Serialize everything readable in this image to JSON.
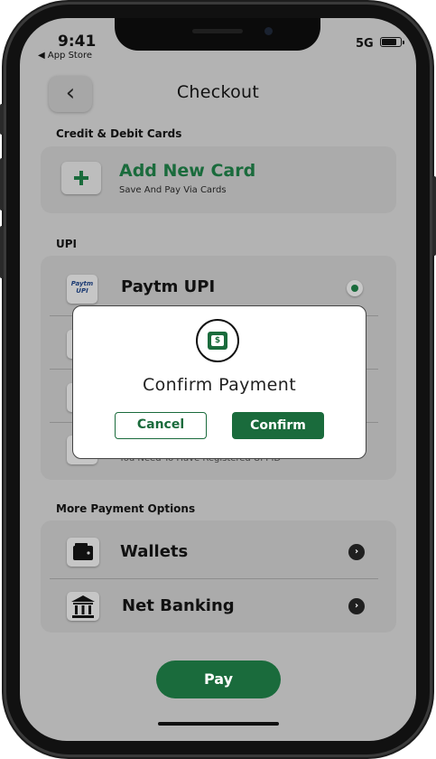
{
  "status_bar": {
    "time": "9:41",
    "back_app": "◀ App Store",
    "network": "5G"
  },
  "header": {
    "title": "Checkout",
    "back_icon": "chevron-left-icon"
  },
  "sections": {
    "cards": "Credit & Debit Cards",
    "upi": "UPI",
    "more": "More Payment Options"
  },
  "add_card": {
    "title": "Add New Card",
    "subtitle": "Save And Pay Via Cards",
    "icon": "plus-icon"
  },
  "upi_options": [
    {
      "label": "Paytm UPI",
      "logo_top": "Paytm",
      "logo_bottom": "UPI",
      "selected": true
    },
    {
      "subtitle": "You Need To Have Registered UPI ID"
    }
  ],
  "more_options": [
    {
      "label": "Wallets",
      "icon": "wallet-icon"
    },
    {
      "label": "Net Banking",
      "icon": "bank-icon"
    }
  ],
  "pay_button": "Pay",
  "modal": {
    "title": "Confirm Payment",
    "icon": "payment-icon",
    "icon_glyph": "$",
    "cancel": "Cancel",
    "confirm": "Confirm"
  },
  "colors": {
    "accent": "#1a6b3c",
    "overlay_bg": "#b3b3b3",
    "card_bg": "#ababab"
  }
}
